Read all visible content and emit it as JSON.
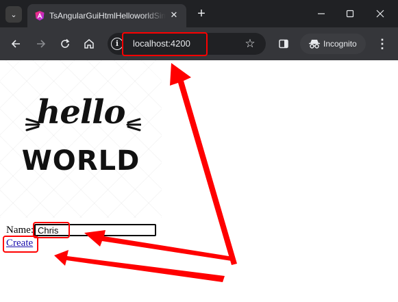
{
  "browser": {
    "tab_title": "TsAngularGuiHtmlHelloworldSimple",
    "url": "localhost:4200",
    "incognito_label": "Incognito"
  },
  "page": {
    "logo": {
      "line1": "hello",
      "line2": "WORLD"
    },
    "form": {
      "name_label": "Name:",
      "name_value": "Chris",
      "create_link": "Create"
    }
  },
  "annotation_color": "#ff0000"
}
